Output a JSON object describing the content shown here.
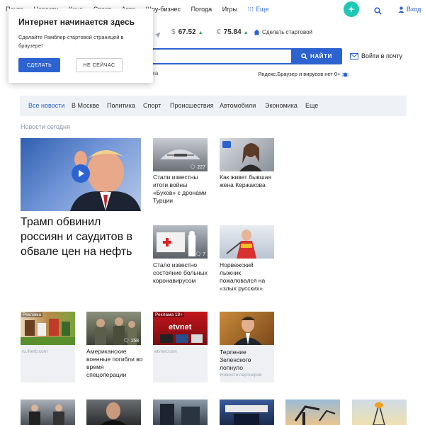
{
  "topnav": {
    "items": [
      "Почта",
      "Новости",
      "Кино",
      "Спорт",
      "Авто",
      "Шоу-бизнес",
      "Погода",
      "Игры"
    ],
    "more_label": "Еще",
    "login_label": "Вход"
  },
  "rates": {
    "usd_symbol": "$",
    "usd_value": "67.52",
    "eur_symbol": "€",
    "eur_value": "75.84",
    "startpage_label": "Сделать стартовой"
  },
  "search": {
    "placeholder": "е",
    "button_label": "НАЙТИ",
    "mail_label": "Войти в почту",
    "sub_left": "ха",
    "promo": "Яндекс.Браузер и вирусов нет 0+"
  },
  "popup": {
    "title": "Интернет начинается здесь",
    "text": "Сделайте Рамблер стартовой страницей в браузере!",
    "confirm_label": "СДЕЛАТЬ",
    "dismiss_label": "НЕ СЕЙЧАС"
  },
  "categories": [
    "Все новости",
    "В Москве",
    "Политика",
    "Спорт",
    "Происшествия",
    "Автомобили",
    "Экономика",
    "Еще"
  ],
  "section_title": "Новости сегодня",
  "main_story": {
    "headline": "Трамп обвинил россиян и саудитов в обвале цен на нефть"
  },
  "stories": [
    {
      "caption": "Стали известны итоги войны «Буков» с дронами Турции",
      "comments": "227"
    },
    {
      "caption": "Как живет бывшая жена Кержакова",
      "comments": ""
    },
    {
      "caption": "Стало известно состояние больных коронавирусом",
      "comments": "7"
    },
    {
      "caption": "Норвежский лыжник пожаловался на «злых русских»",
      "comments": ""
    }
  ],
  "cards": [
    {
      "label": "Реклама",
      "source": "ru.iherb.com",
      "caption": ""
    },
    {
      "label": "",
      "source": "",
      "caption": "Американские военные погибли во время спецоперации",
      "comments": "158"
    },
    {
      "label": "Реклама 18+",
      "source": "etvnet.com",
      "caption": ""
    },
    {
      "label": "",
      "source": "Новости партнеров",
      "caption": "Терпение Зеленского лопнуло"
    }
  ],
  "colors": {
    "accent": "#2d63d0",
    "teal": "#1fc8b4",
    "up": "#27a65a"
  }
}
